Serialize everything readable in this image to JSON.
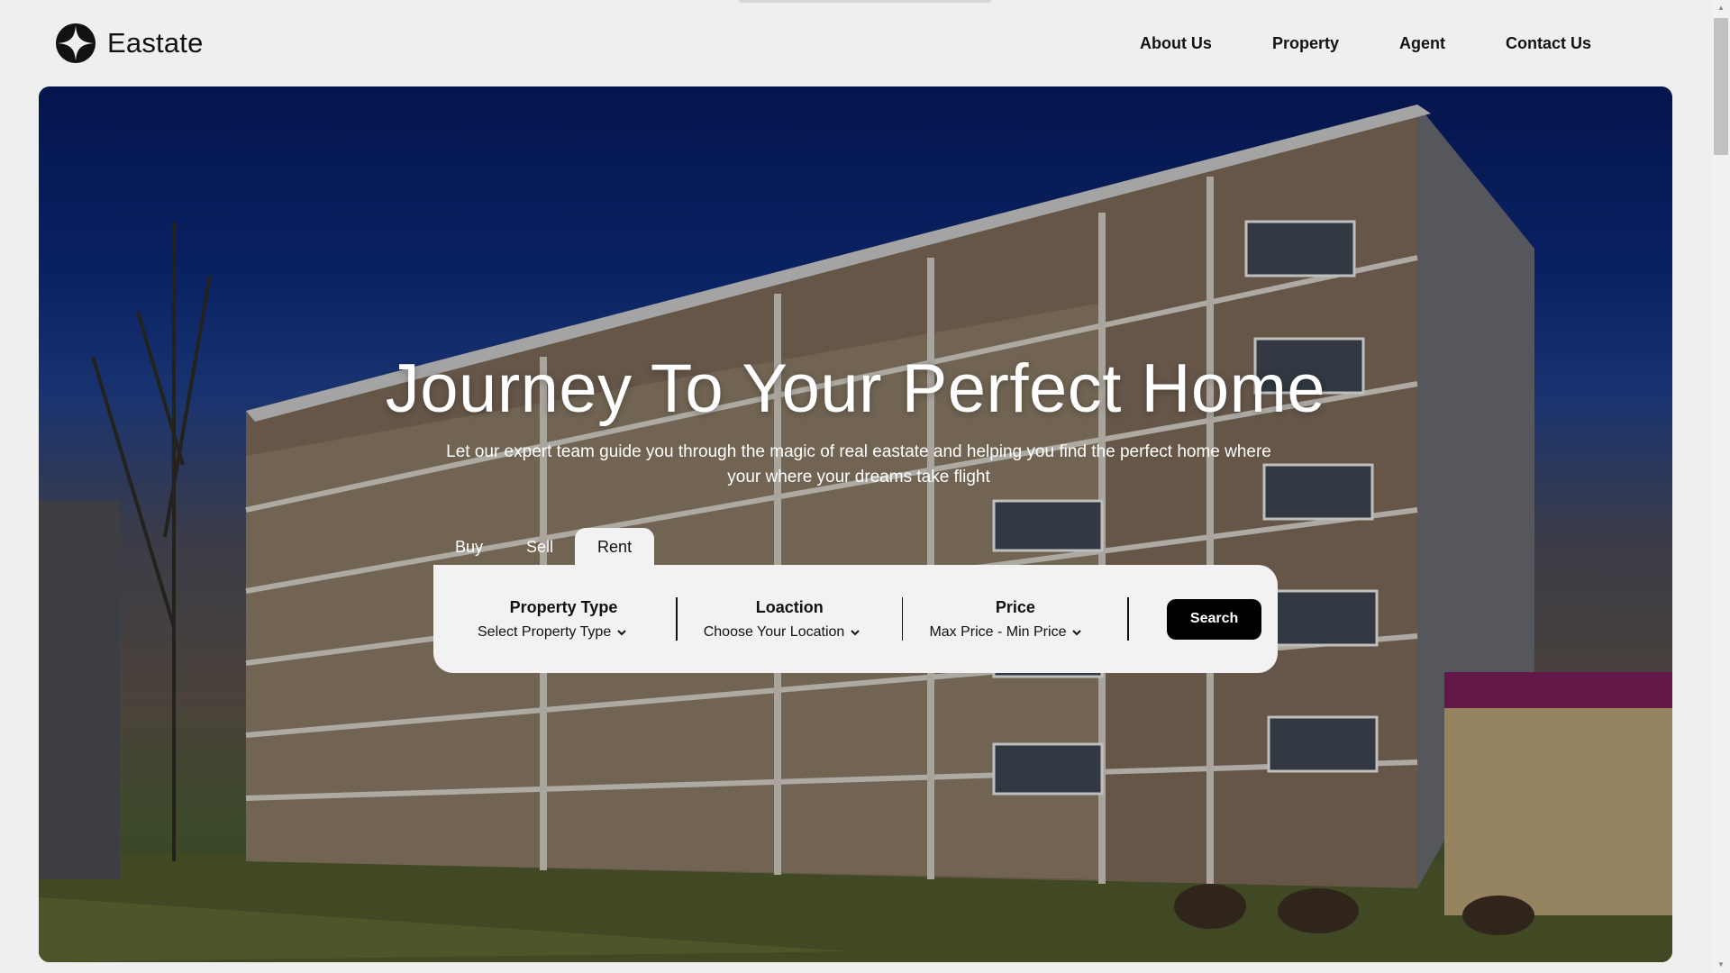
{
  "brand": {
    "name": "Eastate",
    "logo_icon": "compass-star-icon"
  },
  "nav": {
    "items": [
      "About Us",
      "Property",
      "Agent",
      "Contact Us"
    ]
  },
  "hero": {
    "title": "Journey To Your Perfect Home",
    "subtitle": "Let our expert team guide you through the magic of real eastate and helping you find the perfect home where your where your dreams take flight"
  },
  "search": {
    "tabs": [
      "Buy",
      "Sell",
      "Rent"
    ],
    "active_tab": "Rent",
    "fields": [
      {
        "label": "Property Type",
        "value": "Select Property Type"
      },
      {
        "label": "Loaction",
        "value": "Choose Your Location"
      },
      {
        "label": "Price",
        "value": "Max Price - Min Price"
      }
    ],
    "button_label": "Search"
  },
  "colors": {
    "accent": "#000000",
    "panel": "#f2f2f2",
    "page_bg": "#efefef"
  }
}
